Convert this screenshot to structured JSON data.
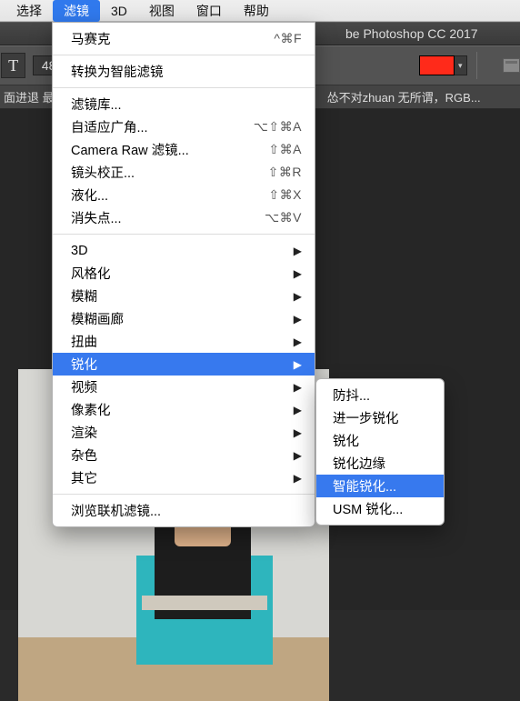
{
  "menubar": {
    "items": [
      "选择",
      "滤镜",
      "3D",
      "视图",
      "窗口",
      "帮助"
    ],
    "active_index": 1
  },
  "titlebar": {
    "app_name": "be Photoshop CC 2017"
  },
  "optionsbar": {
    "tool_glyph": "T",
    "font_size_value": "48",
    "swatch_color": "#ff2a1a"
  },
  "doctabbar": {
    "left_text": "面进退 最",
    "doc_title": "怂不对zhuan 无所谓，RGB..."
  },
  "filter_menu": {
    "last_filter": {
      "label": "马赛克",
      "shortcut": "^⌘F"
    },
    "convert": {
      "label": "转换为智能滤镜"
    },
    "group1": [
      {
        "label": "滤镜库..."
      },
      {
        "label": "自适应广角...",
        "shortcut": "⌥⇧⌘A"
      },
      {
        "label": "Camera Raw 滤镜...",
        "shortcut": "⇧⌘A"
      },
      {
        "label": "镜头校正...",
        "shortcut": "⇧⌘R"
      },
      {
        "label": "液化...",
        "shortcut": "⇧⌘X"
      },
      {
        "label": "消失点...",
        "shortcut": "⌥⌘V"
      }
    ],
    "group2": [
      {
        "label": "3D"
      },
      {
        "label": "风格化"
      },
      {
        "label": "模糊"
      },
      {
        "label": "模糊画廊"
      },
      {
        "label": "扭曲"
      },
      {
        "label": "锐化",
        "highlight": true
      },
      {
        "label": "视频"
      },
      {
        "label": "像素化"
      },
      {
        "label": "渲染"
      },
      {
        "label": "杂色"
      },
      {
        "label": "其它"
      }
    ],
    "browse": {
      "label": "浏览联机滤镜..."
    }
  },
  "sharpen_submenu": {
    "items": [
      {
        "label": "防抖..."
      },
      {
        "label": "进一步锐化"
      },
      {
        "label": "锐化"
      },
      {
        "label": "锐化边缘"
      },
      {
        "label": "智能锐化...",
        "highlight": true
      },
      {
        "label": "USM 锐化..."
      }
    ]
  }
}
